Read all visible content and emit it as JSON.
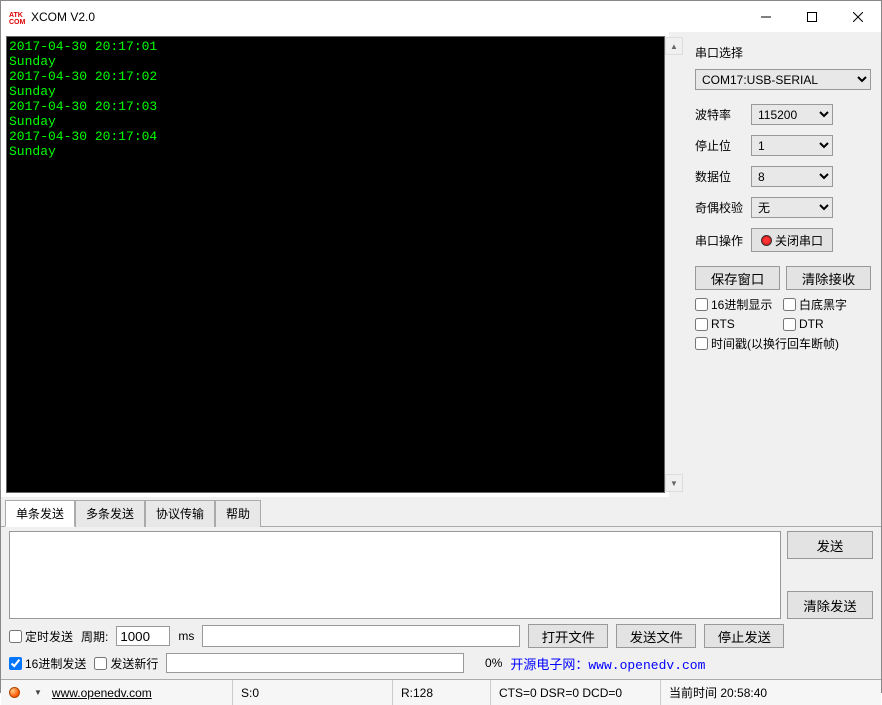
{
  "window": {
    "title": "XCOM V2.0"
  },
  "terminal": {
    "lines": [
      "2017-04-30 20:17:01",
      "Sunday",
      "2017-04-30 20:17:02",
      "Sunday",
      "2017-04-30 20:17:03",
      "Sunday",
      "2017-04-30 20:17:04",
      "Sunday"
    ]
  },
  "side": {
    "group_title": "串口选择",
    "port_selected": "COM17:USB-SERIAL",
    "rows": {
      "baud": {
        "label": "波特率",
        "value": "115200"
      },
      "stop": {
        "label": "停止位",
        "value": "1"
      },
      "data": {
        "label": "数据位",
        "value": "8"
      },
      "parity": {
        "label": "奇偶校验",
        "value": "无"
      },
      "op": {
        "label": "串口操作",
        "button": "关闭串口"
      }
    },
    "btns": {
      "save": "保存窗口",
      "clear": "清除接收"
    },
    "chks": {
      "hex_disp": "16进制显示",
      "white_bg": "白底黑字",
      "rts": "RTS",
      "dtr": "DTR",
      "timestamp": "时间戳(以换行回车断帧)"
    }
  },
  "tabs": {
    "t1": "单条发送",
    "t2": "多条发送",
    "t3": "协议传输",
    "t4": "帮助"
  },
  "send": {
    "textbox": "",
    "btn_send": "发送",
    "btn_clear": "清除发送"
  },
  "opts": {
    "timed_send": "定时发送",
    "period_label": "周期:",
    "period_value": "1000",
    "period_unit": "ms",
    "open_file": "打开文件",
    "send_file": "发送文件",
    "stop_send": "停止发送",
    "hex_send": "16进制发送",
    "send_newline": "发送新行",
    "progress_pct": "0%",
    "link_text": "开源电子网：www.openedv.com"
  },
  "status": {
    "url": "www.openedv.com",
    "tx": "S:0",
    "rx": "R:128",
    "lines": "CTS=0 DSR=0 DCD=0",
    "time_label": "当前时间 20:58:40"
  }
}
